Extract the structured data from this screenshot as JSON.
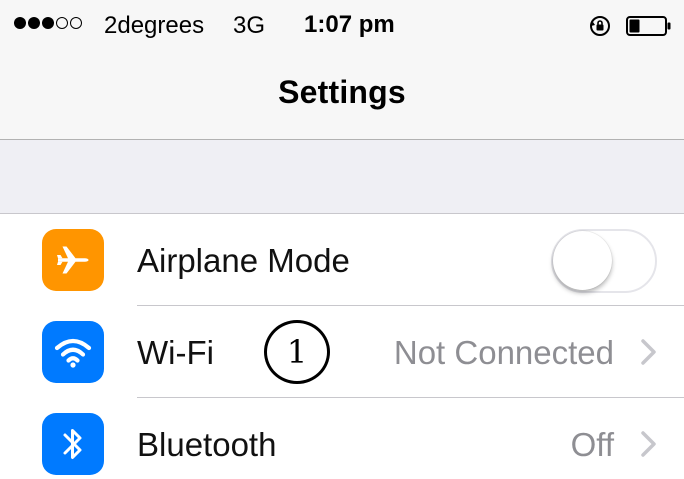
{
  "status_bar": {
    "signal_filled": 3,
    "signal_empty": 2,
    "carrier": "2degrees",
    "network": "3G",
    "time": "1:07 pm",
    "icons": [
      "rotation-lock-icon",
      "battery-icon"
    ],
    "battery_level": 0.3
  },
  "nav": {
    "title": "Settings"
  },
  "settings": {
    "items": [
      {
        "label": "Airplane Mode",
        "icon": "airplane-icon",
        "icon_color": "#ff9500",
        "control": "toggle",
        "toggle_on": false
      },
      {
        "label": "Wi-Fi",
        "icon": "wifi-icon",
        "icon_color": "#007aff",
        "detail": "Not Connected",
        "control": "chevron"
      },
      {
        "label": "Bluetooth",
        "icon": "bluetooth-icon",
        "icon_color": "#007aff",
        "detail": "Off",
        "control": "chevron"
      }
    ]
  },
  "annotation": {
    "label": "1"
  },
  "colors": {
    "bar_background": "#f7f7f7",
    "group_background": "#efeff4",
    "detail_text": "#8e8e93",
    "separator": "#c8c7cc"
  }
}
